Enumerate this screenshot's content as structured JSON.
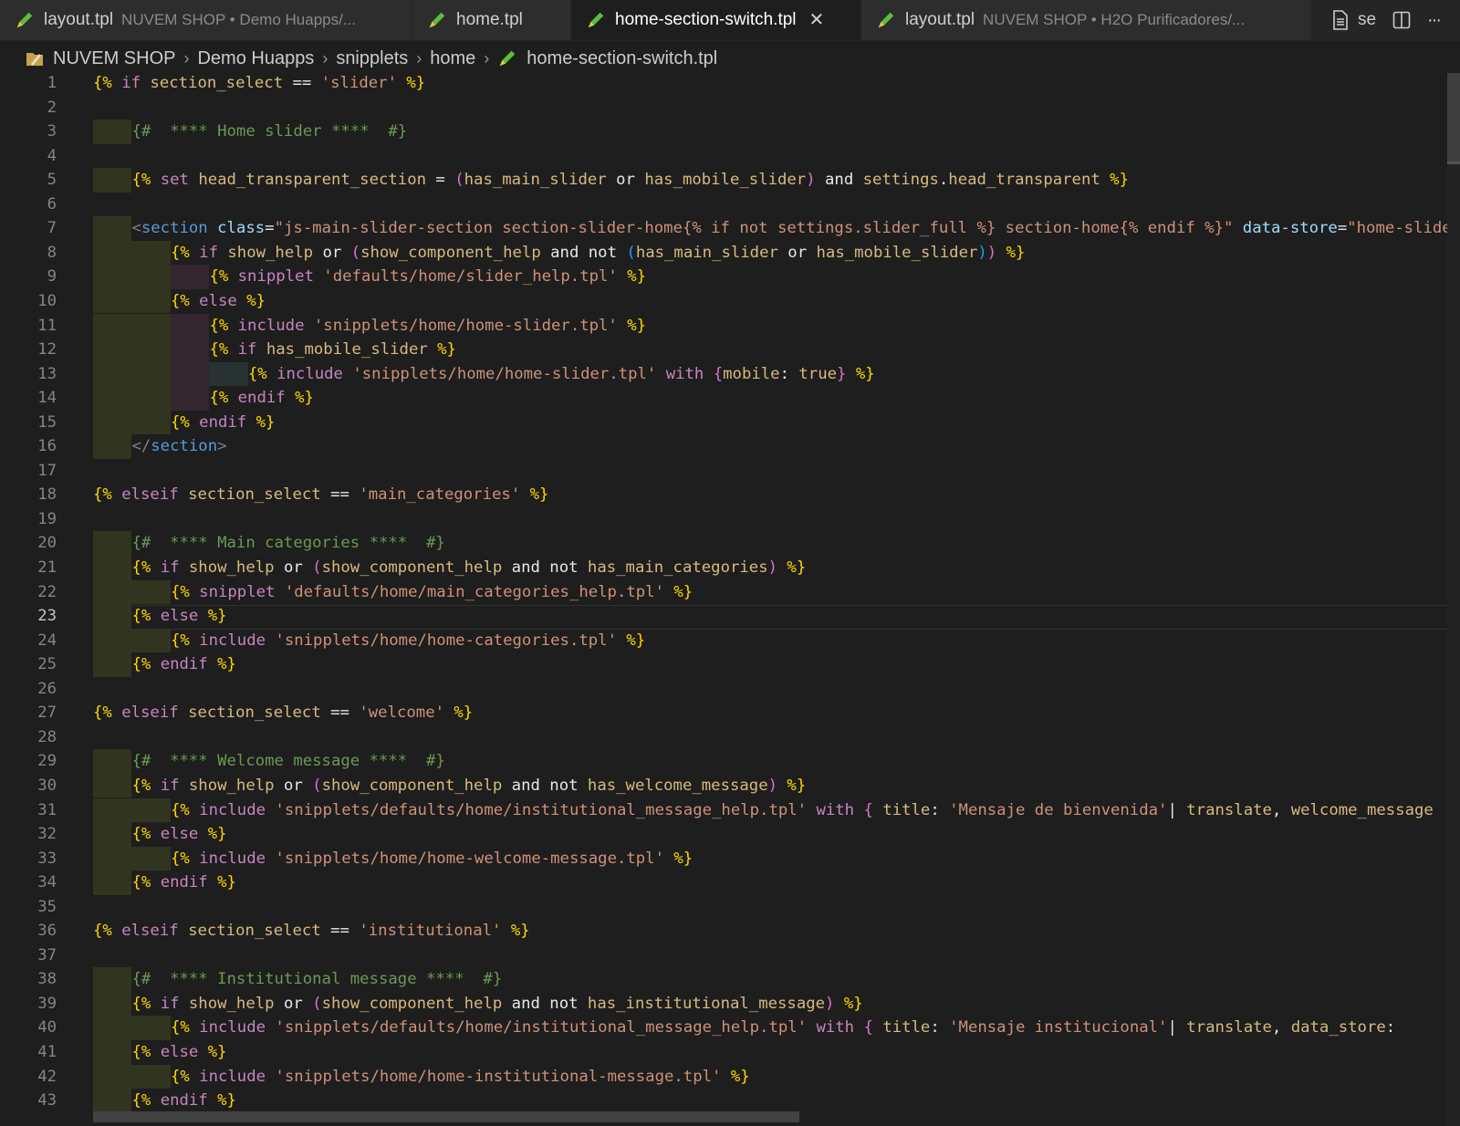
{
  "tabs": [
    {
      "title": "layout.tpl",
      "description": "NUVEM SHOP • Demo Huapps/...",
      "active": false
    },
    {
      "title": "home.tpl",
      "description": "",
      "active": false
    },
    {
      "title": "home-section-switch.tpl",
      "description": "",
      "active": true
    },
    {
      "title": "layout.tpl",
      "description": "NUVEM SHOP • H2O Purificadores/...",
      "active": false
    }
  ],
  "tab_actions": {
    "truncated_label": "se",
    "icons": [
      "file-icon",
      "split-editor-icon",
      "more-icon"
    ]
  },
  "close_glyph": "✕",
  "more_glyph": "···",
  "breadcrumb": [
    "NUVEM SHOP",
    "Demo Huapps",
    "snipplets",
    "home",
    "home-section-switch.tpl"
  ],
  "breadcrumb_sep": "›",
  "editor": {
    "start_line": 1,
    "active_line": 23,
    "colors": {
      "background": "#1e1e1e",
      "delimiter": "#ffd700",
      "keyword": "#c586c0",
      "variable": "#d7ba7d",
      "string": "#ce9178",
      "comment": "#6a9955",
      "guide_green": "#31341f",
      "guide_purple": "#33262f",
      "guide_teal": "#283233"
    },
    "lines": [
      [
        [
          "d",
          "{%"
        ],
        [
          "n",
          " "
        ],
        [
          "k",
          "if"
        ],
        [
          "n",
          " "
        ],
        [
          "v",
          "section_select"
        ],
        [
          "n",
          " "
        ],
        [
          "o",
          "=="
        ],
        [
          "n",
          " "
        ],
        [
          "s",
          "'slider'"
        ],
        [
          "n",
          " "
        ],
        [
          "d",
          "%}"
        ]
      ],
      [],
      [
        [
          "c",
          "{#  **** Home slider ****  #}"
        ]
      ],
      [],
      [
        [
          "d",
          "{%"
        ],
        [
          "n",
          " "
        ],
        [
          "k",
          "set"
        ],
        [
          "n",
          " "
        ],
        [
          "v",
          "head_transparent_section"
        ],
        [
          "n",
          " "
        ],
        [
          "o",
          "="
        ],
        [
          "n",
          " "
        ],
        [
          "p",
          "("
        ],
        [
          "v",
          "has_main_slider"
        ],
        [
          "n",
          " "
        ],
        [
          "o",
          "or"
        ],
        [
          "n",
          " "
        ],
        [
          "v",
          "has_mobile_slider"
        ],
        [
          "p",
          ")"
        ],
        [
          "n",
          " "
        ],
        [
          "o",
          "and"
        ],
        [
          "n",
          " "
        ],
        [
          "v",
          "settings"
        ],
        [
          "o",
          "."
        ],
        [
          "v",
          "head_transparent"
        ],
        [
          "n",
          " "
        ],
        [
          "d",
          "%}"
        ]
      ],
      [],
      [
        [
          "g",
          "<"
        ],
        [
          "tag",
          "section"
        ],
        [
          "n",
          " "
        ],
        [
          "at",
          "class"
        ],
        [
          "o",
          "="
        ],
        [
          "s",
          "\"js-main-slider-section section-slider-home{% if not settings.slider_full %} section-home{% endif %}\""
        ],
        [
          "n",
          " "
        ],
        [
          "at",
          "data-store"
        ],
        [
          "o",
          "="
        ],
        [
          "s",
          "\"home-slider\""
        ]
      ],
      [
        [
          "d",
          "{%"
        ],
        [
          "n",
          " "
        ],
        [
          "k",
          "if"
        ],
        [
          "n",
          " "
        ],
        [
          "v",
          "show_help"
        ],
        [
          "n",
          " "
        ],
        [
          "o",
          "or"
        ],
        [
          "n",
          " "
        ],
        [
          "p",
          "("
        ],
        [
          "v",
          "show_component_help"
        ],
        [
          "n",
          " "
        ],
        [
          "o",
          "and"
        ],
        [
          "n",
          " "
        ],
        [
          "o",
          "not"
        ],
        [
          "n",
          " "
        ],
        [
          "b",
          "("
        ],
        [
          "v",
          "has_main_slider"
        ],
        [
          "n",
          " "
        ],
        [
          "o",
          "or"
        ],
        [
          "n",
          " "
        ],
        [
          "v",
          "has_mobile_slider"
        ],
        [
          "b",
          ")"
        ],
        [
          "p",
          ")"
        ],
        [
          "n",
          " "
        ],
        [
          "d",
          "%}"
        ]
      ],
      [
        [
          "d",
          "{%"
        ],
        [
          "n",
          " "
        ],
        [
          "k",
          "snipplet"
        ],
        [
          "n",
          " "
        ],
        [
          "s",
          "'defaults/home/slider_help.tpl'"
        ],
        [
          "n",
          " "
        ],
        [
          "d",
          "%}"
        ]
      ],
      [
        [
          "d",
          "{%"
        ],
        [
          "n",
          " "
        ],
        [
          "k",
          "else"
        ],
        [
          "n",
          " "
        ],
        [
          "d",
          "%}"
        ]
      ],
      [
        [
          "d",
          "{%"
        ],
        [
          "n",
          " "
        ],
        [
          "k",
          "include"
        ],
        [
          "n",
          " "
        ],
        [
          "s",
          "'snipplets/home/home-slider.tpl'"
        ],
        [
          "n",
          " "
        ],
        [
          "d",
          "%}"
        ]
      ],
      [
        [
          "d",
          "{%"
        ],
        [
          "n",
          " "
        ],
        [
          "k",
          "if"
        ],
        [
          "n",
          " "
        ],
        [
          "v",
          "has_mobile_slider"
        ],
        [
          "n",
          " "
        ],
        [
          "d",
          "%}"
        ]
      ],
      [
        [
          "d",
          "{%"
        ],
        [
          "n",
          " "
        ],
        [
          "k",
          "include"
        ],
        [
          "n",
          " "
        ],
        [
          "s",
          "'snipplets/home/home-slider.tpl'"
        ],
        [
          "n",
          " "
        ],
        [
          "k",
          "with"
        ],
        [
          "n",
          " "
        ],
        [
          "p",
          "{"
        ],
        [
          "v",
          "mobile"
        ],
        [
          "o",
          ":"
        ],
        [
          "n",
          " "
        ],
        [
          "v",
          "true"
        ],
        [
          "p",
          "}"
        ],
        [
          "n",
          " "
        ],
        [
          "d",
          "%}"
        ]
      ],
      [
        [
          "d",
          "{%"
        ],
        [
          "n",
          " "
        ],
        [
          "k",
          "endif"
        ],
        [
          "n",
          " "
        ],
        [
          "d",
          "%}"
        ]
      ],
      [
        [
          "d",
          "{%"
        ],
        [
          "n",
          " "
        ],
        [
          "k",
          "endif"
        ],
        [
          "n",
          " "
        ],
        [
          "d",
          "%}"
        ]
      ],
      [
        [
          "g",
          "</"
        ],
        [
          "tag",
          "section"
        ],
        [
          "g",
          ">"
        ]
      ],
      [],
      [
        [
          "d",
          "{%"
        ],
        [
          "n",
          " "
        ],
        [
          "k",
          "elseif"
        ],
        [
          "n",
          " "
        ],
        [
          "v",
          "section_select"
        ],
        [
          "n",
          " "
        ],
        [
          "o",
          "=="
        ],
        [
          "n",
          " "
        ],
        [
          "s",
          "'main_categories'"
        ],
        [
          "n",
          " "
        ],
        [
          "d",
          "%}"
        ]
      ],
      [],
      [
        [
          "c",
          "{#  **** Main categories ****  #}"
        ]
      ],
      [
        [
          "d",
          "{%"
        ],
        [
          "n",
          " "
        ],
        [
          "k",
          "if"
        ],
        [
          "n",
          " "
        ],
        [
          "v",
          "show_help"
        ],
        [
          "n",
          " "
        ],
        [
          "o",
          "or"
        ],
        [
          "n",
          " "
        ],
        [
          "p",
          "("
        ],
        [
          "v",
          "show_component_help"
        ],
        [
          "n",
          " "
        ],
        [
          "o",
          "and"
        ],
        [
          "n",
          " "
        ],
        [
          "o",
          "not"
        ],
        [
          "n",
          " "
        ],
        [
          "v",
          "has_main_categories"
        ],
        [
          "p",
          ")"
        ],
        [
          "n",
          " "
        ],
        [
          "d",
          "%}"
        ]
      ],
      [
        [
          "d",
          "{%"
        ],
        [
          "n",
          " "
        ],
        [
          "k",
          "snipplet"
        ],
        [
          "n",
          " "
        ],
        [
          "s",
          "'defaults/home/main_categories_help.tpl'"
        ],
        [
          "n",
          " "
        ],
        [
          "d",
          "%}"
        ]
      ],
      [
        [
          "d",
          "{%"
        ],
        [
          "n",
          " "
        ],
        [
          "k",
          "else"
        ],
        [
          "n",
          " "
        ],
        [
          "d",
          "%}"
        ]
      ],
      [
        [
          "d",
          "{%"
        ],
        [
          "n",
          " "
        ],
        [
          "k",
          "include"
        ],
        [
          "n",
          " "
        ],
        [
          "s",
          "'snipplets/home/home-categories.tpl'"
        ],
        [
          "n",
          " "
        ],
        [
          "d",
          "%}"
        ]
      ],
      [
        [
          "d",
          "{%"
        ],
        [
          "n",
          " "
        ],
        [
          "k",
          "endif"
        ],
        [
          "n",
          " "
        ],
        [
          "d",
          "%}"
        ]
      ],
      [],
      [
        [
          "d",
          "{%"
        ],
        [
          "n",
          " "
        ],
        [
          "k",
          "elseif"
        ],
        [
          "n",
          " "
        ],
        [
          "v",
          "section_select"
        ],
        [
          "n",
          " "
        ],
        [
          "o",
          "=="
        ],
        [
          "n",
          " "
        ],
        [
          "s",
          "'welcome'"
        ],
        [
          "n",
          " "
        ],
        [
          "d",
          "%}"
        ]
      ],
      [],
      [
        [
          "c",
          "{#  **** Welcome message ****  #}"
        ]
      ],
      [
        [
          "d",
          "{%"
        ],
        [
          "n",
          " "
        ],
        [
          "k",
          "if"
        ],
        [
          "n",
          " "
        ],
        [
          "v",
          "show_help"
        ],
        [
          "n",
          " "
        ],
        [
          "o",
          "or"
        ],
        [
          "n",
          " "
        ],
        [
          "p",
          "("
        ],
        [
          "v",
          "show_component_help"
        ],
        [
          "n",
          " "
        ],
        [
          "o",
          "and"
        ],
        [
          "n",
          " "
        ],
        [
          "o",
          "not"
        ],
        [
          "n",
          " "
        ],
        [
          "v",
          "has_welcome_message"
        ],
        [
          "p",
          ")"
        ],
        [
          "n",
          " "
        ],
        [
          "d",
          "%}"
        ]
      ],
      [
        [
          "d",
          "{%"
        ],
        [
          "n",
          " "
        ],
        [
          "k",
          "include"
        ],
        [
          "n",
          " "
        ],
        [
          "s",
          "'snipplets/defaults/home/institutional_message_help.tpl'"
        ],
        [
          "n",
          " "
        ],
        [
          "k",
          "with"
        ],
        [
          "n",
          " "
        ],
        [
          "p",
          "{"
        ],
        [
          "n",
          " "
        ],
        [
          "v",
          "title"
        ],
        [
          "o",
          ":"
        ],
        [
          "n",
          " "
        ],
        [
          "s",
          "'Mensaje de bienvenida'"
        ],
        [
          "o",
          "|"
        ],
        [
          "n",
          " "
        ],
        [
          "v",
          "translate"
        ],
        [
          "o",
          ","
        ],
        [
          "n",
          " "
        ],
        [
          "v",
          "welcome_message"
        ]
      ],
      [
        [
          "d",
          "{%"
        ],
        [
          "n",
          " "
        ],
        [
          "k",
          "else"
        ],
        [
          "n",
          " "
        ],
        [
          "d",
          "%}"
        ]
      ],
      [
        [
          "d",
          "{%"
        ],
        [
          "n",
          " "
        ],
        [
          "k",
          "include"
        ],
        [
          "n",
          " "
        ],
        [
          "s",
          "'snipplets/home/home-welcome-message.tpl'"
        ],
        [
          "n",
          " "
        ],
        [
          "d",
          "%}"
        ]
      ],
      [
        [
          "d",
          "{%"
        ],
        [
          "n",
          " "
        ],
        [
          "k",
          "endif"
        ],
        [
          "n",
          " "
        ],
        [
          "d",
          "%}"
        ]
      ],
      [],
      [
        [
          "d",
          "{%"
        ],
        [
          "n",
          " "
        ],
        [
          "k",
          "elseif"
        ],
        [
          "n",
          " "
        ],
        [
          "v",
          "section_select"
        ],
        [
          "n",
          " "
        ],
        [
          "o",
          "=="
        ],
        [
          "n",
          " "
        ],
        [
          "s",
          "'institutional'"
        ],
        [
          "n",
          " "
        ],
        [
          "d",
          "%}"
        ]
      ],
      [],
      [
        [
          "c",
          "{#  **** Institutional message ****  #}"
        ]
      ],
      [
        [
          "d",
          "{%"
        ],
        [
          "n",
          " "
        ],
        [
          "k",
          "if"
        ],
        [
          "n",
          " "
        ],
        [
          "v",
          "show_help"
        ],
        [
          "n",
          " "
        ],
        [
          "o",
          "or"
        ],
        [
          "n",
          " "
        ],
        [
          "p",
          "("
        ],
        [
          "v",
          "show_component_help"
        ],
        [
          "n",
          " "
        ],
        [
          "o",
          "and"
        ],
        [
          "n",
          " "
        ],
        [
          "o",
          "not"
        ],
        [
          "n",
          " "
        ],
        [
          "v",
          "has_institutional_message"
        ],
        [
          "p",
          ")"
        ],
        [
          "n",
          " "
        ],
        [
          "d",
          "%}"
        ]
      ],
      [
        [
          "d",
          "{%"
        ],
        [
          "n",
          " "
        ],
        [
          "k",
          "include"
        ],
        [
          "n",
          " "
        ],
        [
          "s",
          "'snipplets/defaults/home/institutional_message_help.tpl'"
        ],
        [
          "n",
          " "
        ],
        [
          "k",
          "with"
        ],
        [
          "n",
          " "
        ],
        [
          "p",
          "{"
        ],
        [
          "n",
          " "
        ],
        [
          "v",
          "title"
        ],
        [
          "o",
          ":"
        ],
        [
          "n",
          " "
        ],
        [
          "s",
          "'Mensaje institucional'"
        ],
        [
          "o",
          "|"
        ],
        [
          "n",
          " "
        ],
        [
          "v",
          "translate"
        ],
        [
          "o",
          ","
        ],
        [
          "n",
          " "
        ],
        [
          "v",
          "data_store"
        ],
        [
          "o",
          ":"
        ]
      ],
      [
        [
          "d",
          "{%"
        ],
        [
          "n",
          " "
        ],
        [
          "k",
          "else"
        ],
        [
          "n",
          " "
        ],
        [
          "d",
          "%}"
        ]
      ],
      [
        [
          "d",
          "{%"
        ],
        [
          "n",
          " "
        ],
        [
          "k",
          "include"
        ],
        [
          "n",
          " "
        ],
        [
          "s",
          "'snipplets/home/home-institutional-message.tpl'"
        ],
        [
          "n",
          " "
        ],
        [
          "d",
          "%}"
        ]
      ],
      [
        [
          "d",
          "{%"
        ],
        [
          "n",
          " "
        ],
        [
          "k",
          "endif"
        ],
        [
          "n",
          " "
        ],
        [
          "d",
          "%}"
        ]
      ]
    ]
  }
}
